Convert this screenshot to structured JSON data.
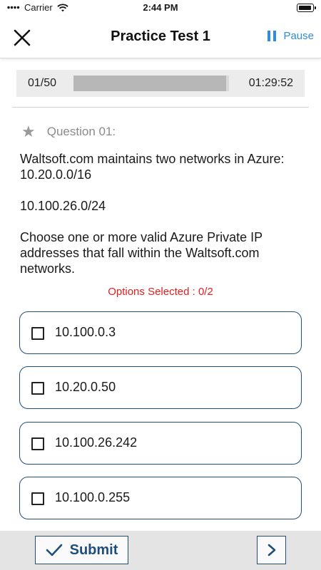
{
  "status_bar": {
    "carrier": "Carrier",
    "time": "2:44 PM",
    "icons": [
      "wifi-icon",
      "battery-icon"
    ]
  },
  "nav": {
    "title": "Practice Test 1",
    "pause_label": "Pause",
    "icons": [
      "close-icon",
      "pause-icon"
    ],
    "accent_color": "#2e8be6"
  },
  "progress": {
    "count": "01/50",
    "fraction_complete": 0.98,
    "timer": "01:29:52"
  },
  "question": {
    "label": "Question 01:",
    "star_icon": "star-icon",
    "paragraphs": [
      "Waltsoft.com maintains two networks in Azure: 10.20.0.0/16",
      "10.100.26.0/24",
      "Choose one or more valid Azure Private IP addresses that fall within the Waltsoft.com networks."
    ]
  },
  "options_selected": "Options Selected : 0/2",
  "options": [
    {
      "label": "10.100.0.3",
      "checked": false
    },
    {
      "label": "10.20.0.50",
      "checked": false
    },
    {
      "label": "10.100.26.242",
      "checked": false
    },
    {
      "label": "10.100.0.255",
      "checked": false
    }
  ],
  "footer": {
    "submit_label": "Submit",
    "icons": [
      "checkmark-icon",
      "chevron-right-icon"
    ],
    "button_color": "#1f4e7a",
    "warning_color": "#e02020"
  }
}
